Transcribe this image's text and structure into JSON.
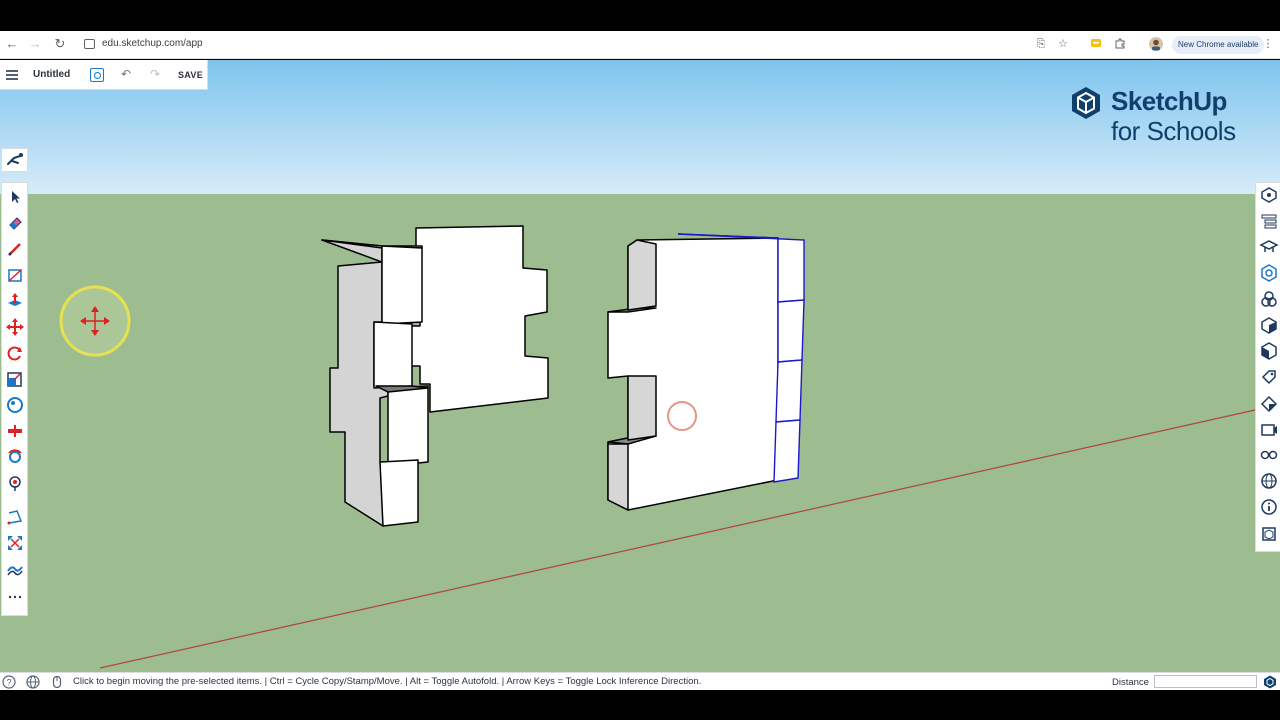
{
  "browser": {
    "url": "edu.sketchup.com/app",
    "update_label": "New Chrome available"
  },
  "app": {
    "doc_title": "Untitled",
    "save_label": "SAVE",
    "logo_name": "SketchUp",
    "logo_sub": "for Schools"
  },
  "left_tools": [
    "select-tool",
    "eraser-tool",
    "pencil-tool",
    "line-tool",
    "push-pull-tool",
    "move-tool",
    "rotate-tool",
    "scale-tool",
    "paint-tool",
    "section-tool",
    "orbit-tool",
    "position-tool",
    "tape-tool",
    "zoom-tool",
    "sandbox-tool",
    "more-tools"
  ],
  "right_panels": [
    "entity-info-icon",
    "outliner-icon",
    "instructor-icon",
    "components-icon",
    "materials-icon",
    "styles-icon",
    "scenes-icon",
    "tags-icon",
    "soften-icon",
    "display-icon",
    "xray-icon",
    "geo-icon",
    "info-icon",
    "model-info-icon"
  ],
  "status": {
    "hint": "Click to begin moving the pre-selected items. | Ctrl = Cycle Copy/Stamp/Move. | Alt = Toggle Autofold. | Arrow Keys = Toggle Lock Inference Direction.",
    "distance_label": "Distance",
    "distance_value": ""
  },
  "colors": {
    "sky_top": "#7fc4ee",
    "ground": "#9dbc8f",
    "selection": "#1a1acc",
    "axis_red": "#b0453a",
    "brand": "#0f3f6d"
  }
}
